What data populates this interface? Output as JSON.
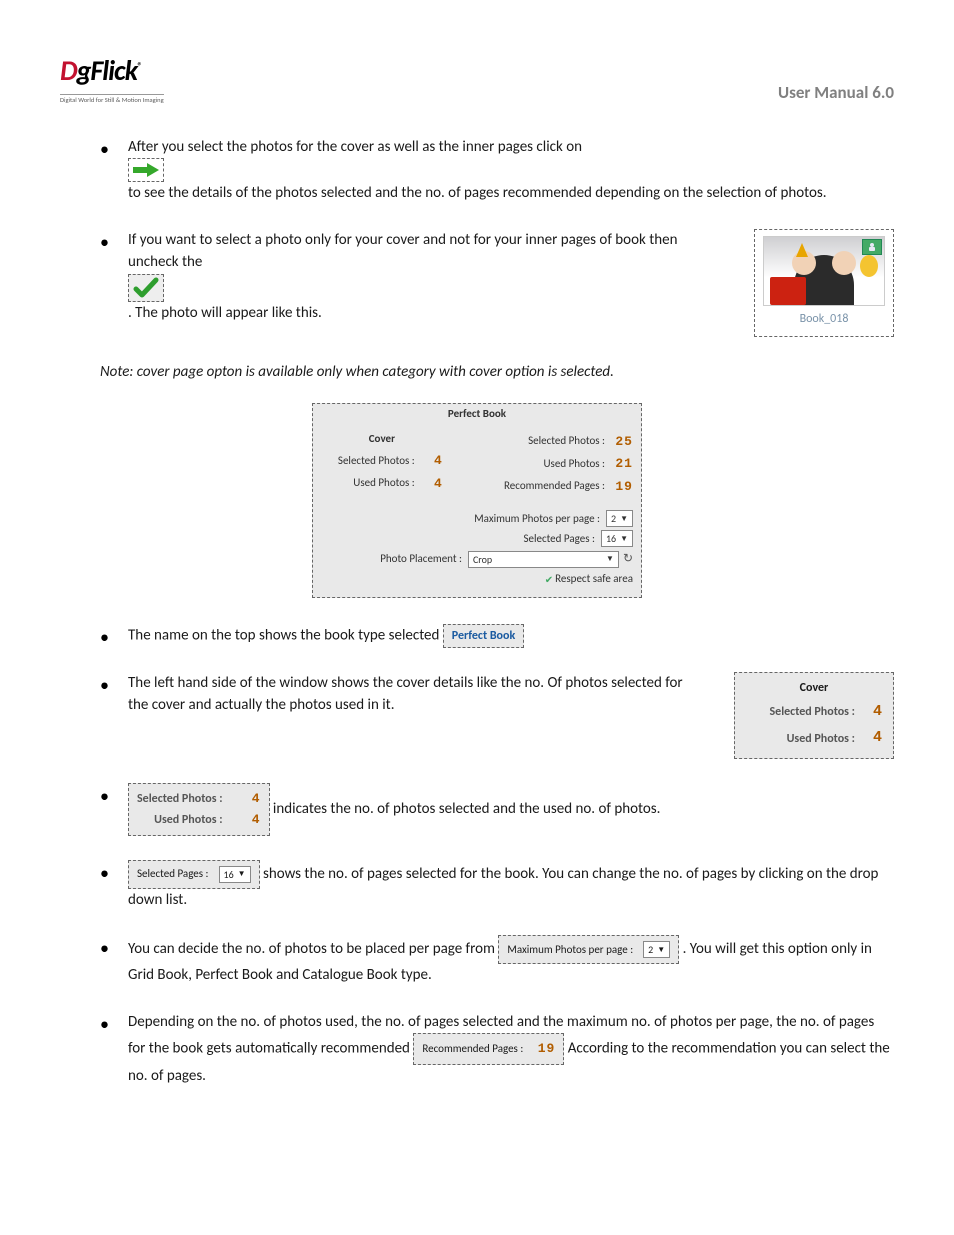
{
  "header": {
    "logo_d": "D",
    "logo_rest": "gFlick",
    "logo_reg": "®",
    "logo_tagline": "Digital World for Still & Motion Imaging",
    "manual_title": "User Manual 6.0"
  },
  "bullets": {
    "b1_a": "After you select the photos for the cover as well as the inner pages click on ",
    "b1_b": " to see the details of the photos selected and the no. of pages recommended depending on the selection of photos.",
    "b2_a": "If you want to select a photo only for your cover and not for your inner pages of book then uncheck the",
    "b2_b": ". The photo will appear like this.",
    "b3_a": "The name on the top shows the book type selected ",
    "b4": "The left hand side of the window shows the cover details like the no. Of photos selected for the cover and actually the photos used in it.",
    "b5": " indicates the no. of photos selected and the used no. of photos.",
    "b6": " shows the no. of pages selected for the book. You can change the no. of pages by clicking on the drop down list.",
    "b7_a": "You can decide the no. of photos to be placed per page from ",
    "b7_b": ". You will get this option only in Grid Book, Perfect Book and Catalogue Book type.",
    "b8_a": "Depending on the no. of photos used, the no. of pages selected and the maximum no. of photos per page, the no. of pages for the book gets automatically recommended ",
    "b8_b": " According to the recommendation you can select the no. of pages."
  },
  "note": "Note: cover page opton is available only when category with cover option is selected.",
  "thumb_label": "Book_018",
  "book_type_chip": "Perfect Book",
  "panel": {
    "title": "Perfect Book",
    "cover_heading": "Cover",
    "cover_selected_label": "Selected Photos :",
    "cover_selected_val": "4",
    "cover_used_label": "Used Photos :",
    "cover_used_val": "4",
    "selected_photos_label": "Selected Photos :",
    "selected_photos_val": "25",
    "used_photos_label": "Used Photos :",
    "used_photos_val": "21",
    "recommended_pages_label": "Recommended  Pages :",
    "recommended_pages_val": "19",
    "max_label": "Maximum Photos per page :",
    "max_val": "2",
    "sel_pages_label": "Selected Pages :",
    "sel_pages_val": "16",
    "placement_label": "Photo Placement :",
    "placement_val": "Crop",
    "respect_label": "Respect safe area"
  },
  "mini_cover": {
    "heading": "Cover",
    "sel_label": "Selected Photos :",
    "sel_val": "4",
    "used_label": "Used Photos :",
    "used_val": "4"
  },
  "inline_sel_used": {
    "sel_label": "Selected Photos :",
    "sel_val": "4",
    "used_label": "Used Photos :",
    "used_val": "4"
  },
  "inline_sel_pages": {
    "label": "Selected Pages :",
    "val": "16"
  },
  "inline_max": {
    "label": "Maximum Photos per page :",
    "val": "2"
  },
  "inline_rec": {
    "label": "Recommended  Pages :",
    "val": "19"
  }
}
